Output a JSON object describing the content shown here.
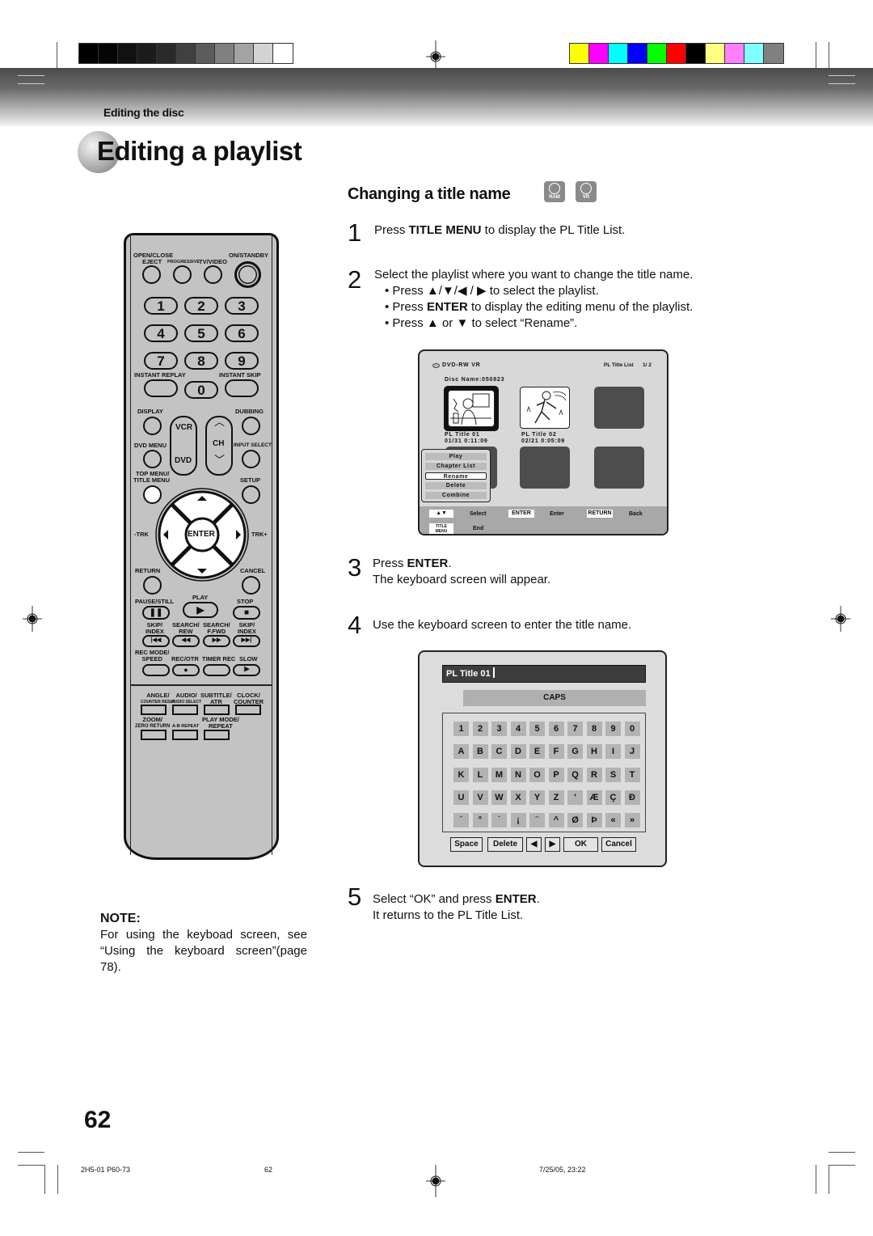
{
  "print_marks": {
    "gray_swatches": [
      "#000000",
      "#050505",
      "#111111",
      "#1c1c1c",
      "#2a2a2a",
      "#404040",
      "#5c5c5c",
      "#808080",
      "#a3a3a3",
      "#d3d3d3",
      "#ffffff"
    ],
    "color_swatches": [
      "#ffff00",
      "#ff00ff",
      "#00ffff",
      "#0000ff",
      "#00ff00",
      "#ff0000",
      "#000000",
      "#ffff80",
      "#ff80ff",
      "#80ffff",
      "#808080"
    ]
  },
  "header": {
    "section_label": "Editing the disc",
    "page_title": "Editing a playlist"
  },
  "subsection": {
    "title": "Changing a title name",
    "badges": [
      "RAM",
      "VR"
    ]
  },
  "steps": [
    {
      "num": "1",
      "parts": [
        [
          "Press ",
          false
        ],
        [
          "TITLE MENU",
          true
        ],
        [
          " to display the PL Title List.",
          false
        ]
      ]
    },
    {
      "num": "2",
      "text": "Select the playlist where you want to change the title name.",
      "bullets": [
        [
          [
            "Press ▲/▼/◀ / ▶ to select the playlist.",
            false
          ]
        ],
        [
          [
            "Press ",
            false
          ],
          [
            "ENTER",
            true
          ],
          [
            " to display the editing menu of the playlist.",
            false
          ]
        ],
        [
          [
            "Press ▲ or ▼ to select “Rename”.",
            false
          ]
        ]
      ]
    },
    {
      "num": "3",
      "line1": [
        [
          "Press ",
          false
        ],
        [
          "ENTER",
          true
        ],
        [
          ".",
          false
        ]
      ],
      "line2": "The keyboard screen will appear."
    },
    {
      "num": "4",
      "text": "Use the keyboard screen to enter the title name."
    },
    {
      "num": "5",
      "line1": [
        [
          "Select “OK” and press ",
          false
        ],
        [
          "ENTER",
          true
        ],
        [
          ".",
          false
        ]
      ],
      "line2": "It returns to the PL Title List."
    }
  ],
  "remote": {
    "top_labels": {
      "open_close": "OPEN/CLOSE",
      "eject": "EJECT",
      "progressive": "PROGRESSIVE",
      "tv_video": "TV/VIDEO",
      "on_standby": "ON/STANDBY"
    },
    "digits": [
      "1",
      "2",
      "3",
      "4",
      "5",
      "6",
      "7",
      "8",
      "9",
      "0"
    ],
    "instant_replay": "INSTANT REPLAY",
    "instant_skip": "INSTANT SKIP",
    "display": "DISPLAY",
    "dubbing": "DUBBING",
    "vcr": "VCR",
    "dvd": "DVD",
    "ch": "CH",
    "dvd_menu": "DVD MENU",
    "input_select": "INPUT SELECT",
    "top_menu": "TOP MENU/",
    "title_menu": "TITLE MENU",
    "setup": "SETUP",
    "enter": "ENTER",
    "trk_minus": "-TRK",
    "trk_plus": "TRK+",
    "return": "RETURN",
    "cancel": "CANCEL",
    "pause_still": "PAUSE/STILL",
    "play": "PLAY",
    "stop": "STOP",
    "skip_index_l1": "SKIP/",
    "skip_index_l2": "INDEX",
    "search_rew_l1": "SEARCH/",
    "search_rew_l2": "REW",
    "search_ffwd_l1": "SEARCH/",
    "search_ffwd_l2": "F.FWD",
    "rec_mode_l1": "REC MODE/",
    "rec_mode_l2": "SPEED",
    "rec_otr": "REC/OTR",
    "timer_rec": "TIMER REC",
    "slow": "SLOW",
    "angle_l1": "ANGLE/",
    "angle_l2": "COUNTER RESET",
    "audio_l1": "AUDIO/",
    "audio_l2": "AUDIO SELECT",
    "subtitle_l1": "SUBTITLE/",
    "subtitle_l2": "ATR",
    "clock_l1": "CLOCK/",
    "clock_l2": "COUNTER",
    "zoom_l1": "ZOOM/",
    "zoom_l2": "ZERO RETURN",
    "ab_repeat": "A-B REPEAT",
    "play_mode_l1": "PLAY MODE/",
    "play_mode_l2": "REPEAT"
  },
  "osd_title_list": {
    "disc_type": "DVD-RW VR",
    "list_label": "PL Title List",
    "page": "1/ 2",
    "disc_name": "Disc Name:050823",
    "titles": [
      {
        "name": "PL Title 01",
        "date_time": "01/31 0:11:09"
      },
      {
        "name": "PL Title 02",
        "date_time": "02/21 0:05:09"
      }
    ],
    "menu": [
      "Play",
      "Chapter List",
      "Rename",
      "Delete",
      "Combine"
    ],
    "selected_menu": "Rename",
    "footer": {
      "updown_key": "▲▼",
      "select": "Select",
      "enter_key": "ENTER",
      "enter": "Enter",
      "return_key": "RETURN",
      "back": "Back",
      "title_menu_key_l1": "TITLE",
      "title_menu_key_l2": "MENU",
      "end": "End"
    }
  },
  "osd_keyboard": {
    "field_value": "PL Title 01",
    "mode": "CAPS",
    "rows": [
      [
        "1",
        "2",
        "3",
        "4",
        "5",
        "6",
        "7",
        "8",
        "9",
        "0"
      ],
      [
        "A",
        "B",
        "C",
        "D",
        "E",
        "F",
        "G",
        "H",
        "I",
        "J"
      ],
      [
        "K",
        "L",
        "M",
        "N",
        "O",
        "P",
        "Q",
        "R",
        "S",
        "T"
      ],
      [
        "U",
        "V",
        "W",
        "X",
        "Y",
        "Z",
        "'",
        "Æ",
        "Ç",
        "Ð"
      ],
      [
        "´",
        "°",
        "˙",
        "¡",
        "¨",
        "^",
        "Ø",
        "Þ",
        "«",
        "»"
      ]
    ],
    "buttons": {
      "space": "Space",
      "delete": "Delete",
      "left": "◀",
      "right": "▶",
      "ok": "OK",
      "cancel": "Cancel"
    }
  },
  "note": {
    "heading": "NOTE:",
    "body": "For using the keyboad screen, see “Using the keyboard screen”(page 78)."
  },
  "page_number": "62",
  "footer": {
    "job_code": "2H5-01 P60-73",
    "page": "62",
    "timestamp": "7/25/05, 23:22"
  }
}
